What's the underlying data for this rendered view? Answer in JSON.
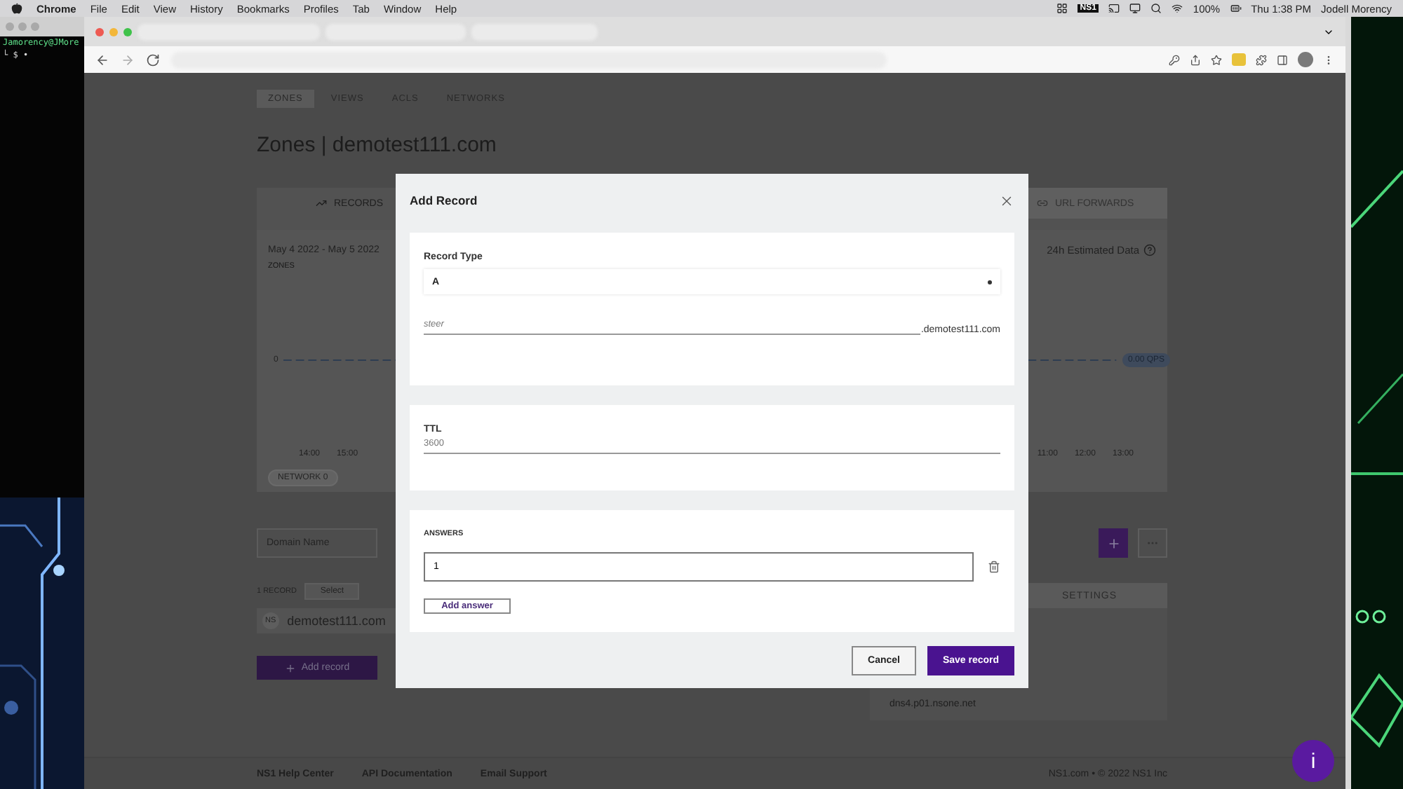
{
  "menu_bar": {
    "app": "Chrome",
    "menus": [
      "File",
      "Edit",
      "View",
      "History",
      "Bookmarks",
      "Profiles",
      "Tab",
      "Window",
      "Help"
    ],
    "status_badge": "NS1",
    "battery": "100%",
    "clock": "Thu 1:38 PM",
    "user": "Jodell Morency"
  },
  "terminal": {
    "lines": [
      "Jamorency@JMore",
      "└ $ •"
    ]
  },
  "page": {
    "nav_tabs": [
      {
        "label": "ZONES",
        "selected": true
      },
      {
        "label": "VIEWS",
        "selected": false
      },
      {
        "label": "ACLS",
        "selected": false
      },
      {
        "label": "NETWORKS",
        "selected": false
      }
    ],
    "title": "Zones | demotest111.com",
    "card_tabs": [
      {
        "label": "RECORDS",
        "selected": true
      },
      {
        "label": "URL FORWARDS",
        "selected": false
      }
    ],
    "chart": {
      "date_range": "May 4 2022 - May 5 2022",
      "subtitle": "ZONES",
      "estimate_label": "24h Estimated Data",
      "y_tick": "0",
      "badge": "0.00 QPS",
      "x_labels_left": [
        "14:00",
        "15:00"
      ],
      "x_labels_right": [
        "11:00",
        "12:00",
        "13:00"
      ],
      "legend_chip": "NETWORK 0"
    },
    "domain_filter": {
      "placeholder": "Domain Name"
    },
    "record_count": "1 RECORD",
    "select_button": "Select",
    "records": [
      {
        "type": "NS",
        "name": "demotest111.com"
      }
    ],
    "add_record": "Add record",
    "settings": {
      "heading": "SETTINGS",
      "nameserver": "dns4.p01.nsone.net"
    },
    "footer": {
      "links": [
        "NS1 Help Center",
        "API Documentation",
        "Email Support"
      ],
      "copyright": "NS1.com • © 2022 NS1 Inc"
    },
    "help_button": "i"
  },
  "modal": {
    "title": "Add Record",
    "record_type_label": "Record Type",
    "record_type": "A",
    "name_value": "steer",
    "zone_suffix": ".demotest111.com",
    "ttl_label": "TTL",
    "ttl_value": "3600",
    "answers_label": "ANSWERS",
    "answers": [
      {
        "value": "1",
        "focused": true
      }
    ],
    "add_answer": "Add answer",
    "buttons": [
      {
        "label": "Cancel",
        "kind": "secondary"
      },
      {
        "label": "Save record",
        "kind": "primary"
      }
    ]
  }
}
